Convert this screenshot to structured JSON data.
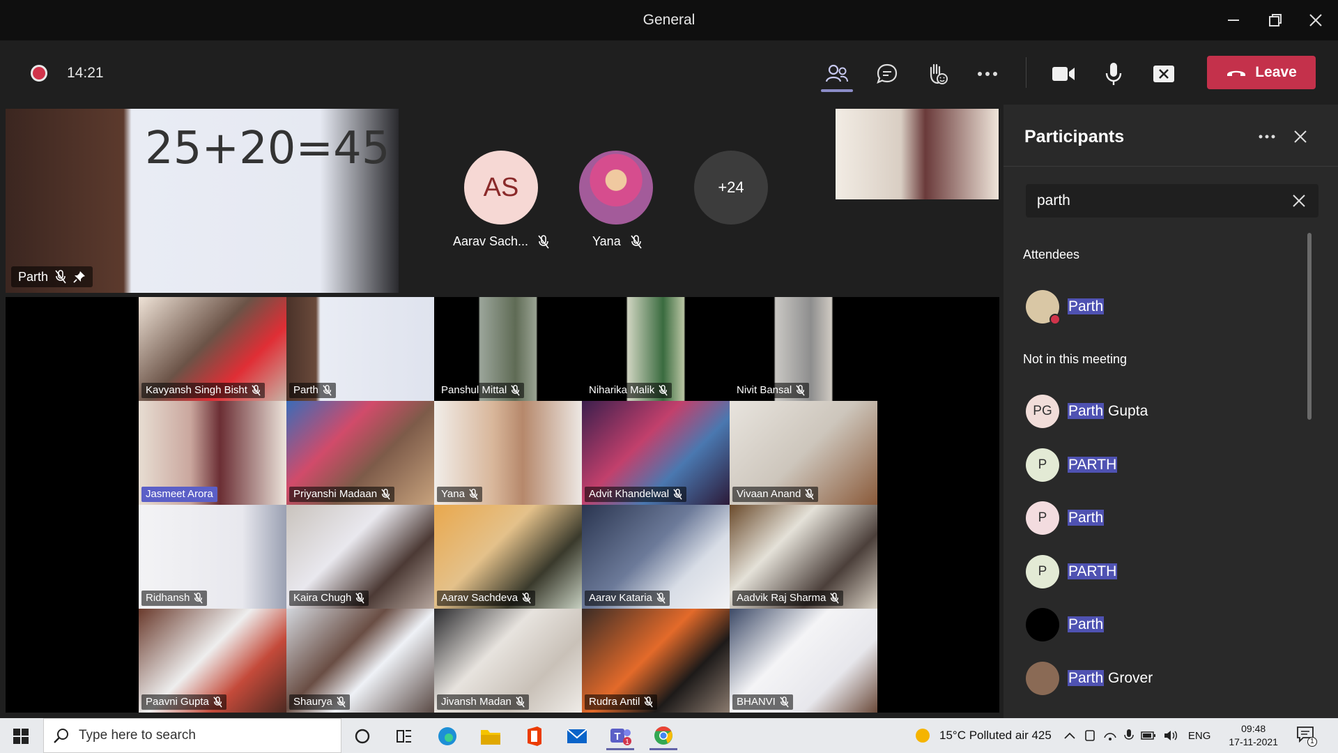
{
  "window": {
    "title": "General"
  },
  "toolbar": {
    "call_time": "14:21",
    "leave_label": "Leave"
  },
  "stage": {
    "pinned": {
      "name": "Parth",
      "paper_text": "25+20=45"
    },
    "avatars": [
      {
        "initials": "AS",
        "label": "Aarav Sach...",
        "bg": "#f6d8d4",
        "fg": "#8a2a2a"
      },
      {
        "initials": "",
        "label": "Yana",
        "bg": "#c57aa6",
        "fg": "#fff"
      },
      {
        "initials": "+24",
        "label": "",
        "bg": "#3c3c3c",
        "fg": "#fff"
      }
    ],
    "tiles": [
      {
        "name": "Kavyansh Singh Bisht",
        "bg": "linear-gradient(135deg,#efe3d7 0%,#6b5347 45%,#e02e35 70%,#c7b2a5 100%)"
      },
      {
        "name": "Parth",
        "bg": "linear-gradient(90deg,#4a3229 0%,#6a4a3b 20%,#e9ecf4 23%,#dfe3ee 100%)"
      },
      {
        "name": "Panshul Mittal",
        "bg": "linear-gradient(90deg,#000 0%,#000 30%,#9ba59a 31%,#5f6b55 55%,#9aa393 69%,#000 70%,#000 100%)"
      },
      {
        "name": "Niharika Malik",
        "bg": "linear-gradient(90deg,#000 0%,#000 30%,#cfd4c0 31%,#3a6b3f 55%,#b8c4a2 69%,#000 70%,#000 100%)"
      },
      {
        "name": "Nivit Bansal",
        "bg": "linear-gradient(90deg,#000 0%,#000 30%,#c9c7c3 31%,#8e8e8e 55%,#cfcac2 69%,#000 70%,#000 100%)"
      },
      {
        "name": "Jasmeet Arora",
        "bg": "linear-gradient(90deg,#e7ddd2 0%,#caa79e 35%,#6b2e34 55%,#ece4db 100%)",
        "highlight": true
      },
      {
        "name": "Priyanshi Madaan",
        "bg": "linear-gradient(135deg,#3a6cb8 0%,#d14b6a 35%,#7d5b49 60%,#c7a27d 100%)"
      },
      {
        "name": "Yana",
        "bg": "linear-gradient(90deg,#f1ede9 0%,#d8b69a 40%,#b6886b 60%,#ede8e4 100%)"
      },
      {
        "name": "Advit Khandelwal",
        "bg": "linear-gradient(135deg,#3b1f4d 0%,#c2406c 40%,#4a78b0 65%,#2c1a38 100%)"
      },
      {
        "name": "Vivaan Anand",
        "bg": "linear-gradient(135deg,#e8e4de 0%,#cdc6bc 50%,#8a5a3a 100%)"
      },
      {
        "name": "Ridhansh",
        "bg": "linear-gradient(90deg,#f3f3f5 0%,#e8e8ee 70%,#9aa0b2 100%)"
      },
      {
        "name": "Kaira Chugh",
        "bg": "linear-gradient(135deg,#c9c3bd 0%,#e9e8ee 40%,#4c3a35 70%,#b7a79f 100%)"
      },
      {
        "name": "Aarav Sachdeva",
        "bg": "linear-gradient(135deg,#e9a84d 0%,#e4c18a 40%,#3a3a2c 70%,#c6cfc0 100%)"
      },
      {
        "name": "Aarav Kataria",
        "bg": "linear-gradient(135deg,#2a3550 0%,#6c7a99 45%,#d8dde6 70%,#f2f2f4 100%)"
      },
      {
        "name": "Aadvik Raj Sharma",
        "bg": "linear-gradient(135deg,#6a4a2b 0%,#e4e1d8 35%,#4b3f3a 70%,#d8d0c3 100%)"
      },
      {
        "name": "Paavni Gupta",
        "bg": "linear-gradient(135deg,#6a3a2c 0%,#eeeeee 45%,#c44a3a 70%,#4d2a22 100%)"
      },
      {
        "name": "Shaurya",
        "bg": "linear-gradient(135deg,#d2d6dc 0%,#6a4e44 40%,#eef1f6 60%,#5a4a45 100%)"
      },
      {
        "name": "Jivansh Madan",
        "bg": "linear-gradient(135deg,#2b2b2e 0%,#e7e3de 40%,#c9c1b8 70%,#efece8 100%)"
      },
      {
        "name": "Rudra Antil",
        "bg": "linear-gradient(135deg,#3a2c26 0%,#e36a2a 45%,#1d1a19 70%,#8a7a6e 100%)"
      },
      {
        "name": "BHANVI",
        "bg": "linear-gradient(135deg,#3d4a67 0%,#f4f4f6 40%,#e7e7ec 70%,#6b4a3a 100%)"
      }
    ]
  },
  "panel": {
    "title": "Participants",
    "search_value": "parth",
    "attendees_heading": "Attendees",
    "attendees": [
      {
        "highlight": "Parth",
        "rest": "",
        "initials": "",
        "avatar_bg": "#d9c7a5",
        "status_color": "#d1344b"
      }
    ],
    "not_in_heading": "Not in this meeting",
    "not_in": [
      {
        "highlight": "Parth",
        "rest": " Gupta",
        "initials": "PG",
        "avatar_bg": "#f1ddd9"
      },
      {
        "highlight": "PARTH",
        "rest": "",
        "initials": "P",
        "avatar_bg": "#e3ead5"
      },
      {
        "highlight": "Parth",
        "rest": "",
        "initials": "P",
        "avatar_bg": "#f3dcdf"
      },
      {
        "highlight": "PARTH",
        "rest": "",
        "initials": "P",
        "avatar_bg": "#e3ead5"
      },
      {
        "highlight": "Parth",
        "rest": "",
        "initials": "",
        "avatar_bg": "#000000"
      },
      {
        "highlight": "Parth",
        "rest": " Grover",
        "initials": "",
        "avatar_bg": "#8a6a55"
      }
    ]
  },
  "taskbar": {
    "search_placeholder": "Type here to search",
    "weather": "15°C  Polluted air 425",
    "language": "ENG",
    "time": "09:48",
    "date": "17-11-2021",
    "notification_count": "1"
  }
}
